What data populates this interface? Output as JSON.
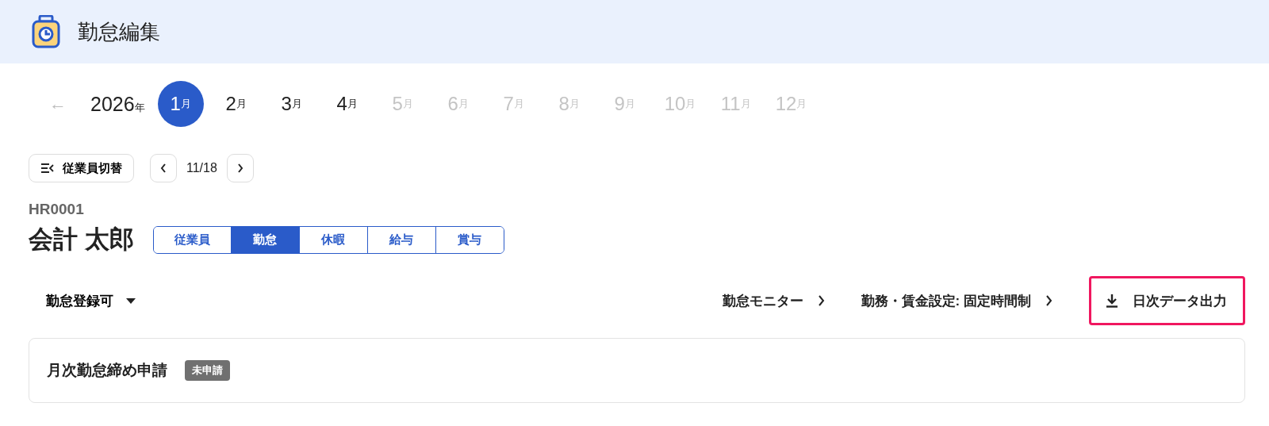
{
  "header": {
    "title": "勤怠編集"
  },
  "year_nav": {
    "prev": "←",
    "year": "2026",
    "year_unit": "年"
  },
  "months": [
    {
      "number": "1",
      "unit": "月",
      "selected": true,
      "disabled": false
    },
    {
      "number": "2",
      "unit": "月",
      "selected": false,
      "disabled": false
    },
    {
      "number": "3",
      "unit": "月",
      "selected": false,
      "disabled": false
    },
    {
      "number": "4",
      "unit": "月",
      "selected": false,
      "disabled": false
    },
    {
      "number": "5",
      "unit": "月",
      "selected": false,
      "disabled": true
    },
    {
      "number": "6",
      "unit": "月",
      "selected": false,
      "disabled": true
    },
    {
      "number": "7",
      "unit": "月",
      "selected": false,
      "disabled": true
    },
    {
      "number": "8",
      "unit": "月",
      "selected": false,
      "disabled": true
    },
    {
      "number": "9",
      "unit": "月",
      "selected": false,
      "disabled": true
    },
    {
      "number": "10",
      "unit": "月",
      "selected": false,
      "disabled": true
    },
    {
      "number": "11",
      "unit": "月",
      "selected": false,
      "disabled": true
    },
    {
      "number": "12",
      "unit": "月",
      "selected": false,
      "disabled": true
    }
  ],
  "employee_switch": {
    "label": "従業員切替",
    "position": "11/18"
  },
  "employee": {
    "code": "HR0001",
    "name": "会計 太郎"
  },
  "tabs": [
    {
      "label": "従業員",
      "selected": false
    },
    {
      "label": "勤怠",
      "selected": true
    },
    {
      "label": "休暇",
      "selected": false
    },
    {
      "label": "給与",
      "selected": false
    },
    {
      "label": "賞与",
      "selected": false
    }
  ],
  "toolbar": {
    "status_dropdown": "勤怠登録可",
    "links": [
      "勤怠モニター",
      "勤務・賃金設定: 固定時間制"
    ],
    "export_button": {
      "label": "日次データ出力",
      "highlighted": true
    }
  },
  "closing_card": {
    "title": "月次勤怠締め申請",
    "status": "未申請"
  }
}
